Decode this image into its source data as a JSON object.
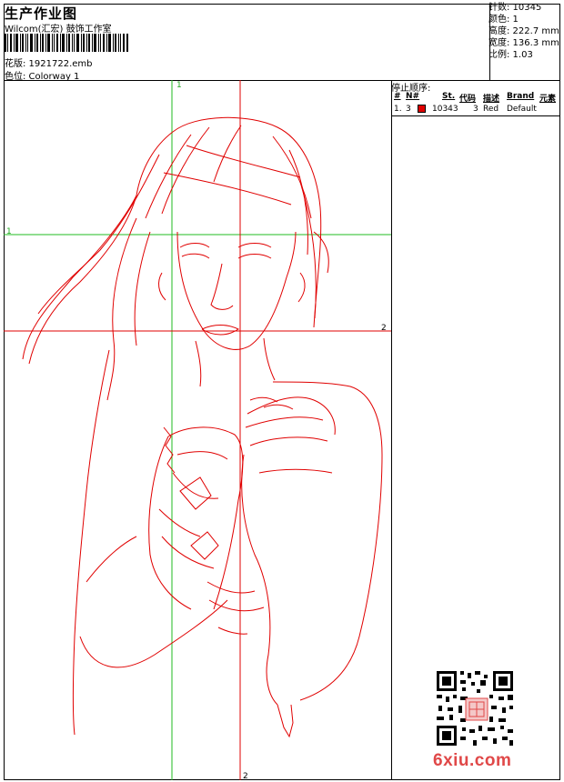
{
  "header": {
    "title": "生产作业图",
    "studio": "Wilcom(汇宏) 鼓饰工作室",
    "design_file": "花版: 1921722.emb",
    "colorway": "色位: Colorway 1"
  },
  "stats": {
    "stitches": "针数: 10345",
    "colors": "颜色: 1",
    "height": "高度: 222.7 mm",
    "width": "宽度: 136.3 mm",
    "scale": "比例: 1.03"
  },
  "stop_sequence": {
    "title": "停止顺序:",
    "headers": [
      "#",
      "N#",
      "St.",
      "代码",
      "描述",
      "Brand",
      "元素"
    ],
    "rows": [
      {
        "index": "1.",
        "needle": "3",
        "stitches": "10343",
        "code": "3",
        "description": "Red",
        "brand": "Default",
        "element": "",
        "color": "#e00000"
      }
    ]
  },
  "guides": {
    "top": "1",
    "left": "1",
    "right": "2",
    "bottom": "2"
  },
  "colors": {
    "thread": "#e00000",
    "guide_green": "#22bb22",
    "guide_red": "#e00000",
    "watermark": "#e04848"
  },
  "icons": [
    "barcode-icon",
    "qr-code-icon"
  ],
  "watermark": "6xiu.com"
}
